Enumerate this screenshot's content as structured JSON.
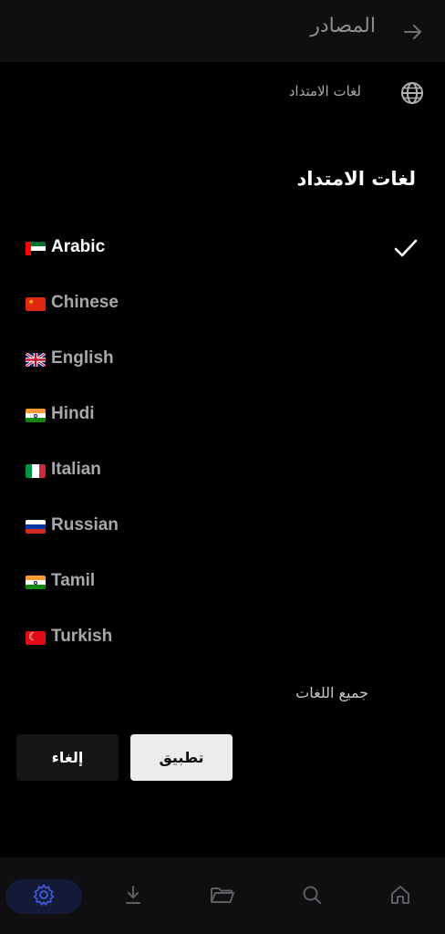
{
  "header": {
    "title": "المصادر",
    "back_icon": "arrow-right-icon"
  },
  "source_row": {
    "label": "لغات الامتداد",
    "icon": "globe-icon"
  },
  "dialog": {
    "title": "لغات الامتداد",
    "languages": [
      {
        "name": "Arabic",
        "flag": "ae",
        "selected": true
      },
      {
        "name": "Chinese",
        "flag": "cn",
        "selected": false
      },
      {
        "name": "English",
        "flag": "gb",
        "selected": false
      },
      {
        "name": "Hindi",
        "flag": "in",
        "selected": false
      },
      {
        "name": "Italian",
        "flag": "it",
        "selected": false
      },
      {
        "name": "Russian",
        "flag": "ru",
        "selected": false
      },
      {
        "name": "Tamil",
        "flag": "in",
        "selected": false
      },
      {
        "name": "Turkish",
        "flag": "tr",
        "selected": false
      }
    ],
    "all_languages_label": "جميع اللغات",
    "apply_label": "تطبيق",
    "cancel_label": "إلغاء"
  },
  "bottom_nav": {
    "items": [
      {
        "icon": "settings-icon",
        "active": true
      },
      {
        "icon": "download-icon",
        "active": false
      },
      {
        "icon": "folder-icon",
        "active": false
      },
      {
        "icon": "search-icon",
        "active": false
      },
      {
        "icon": "home-icon",
        "active": false
      }
    ]
  },
  "colors": {
    "accent": "#3e57d8",
    "background": "#000000"
  }
}
